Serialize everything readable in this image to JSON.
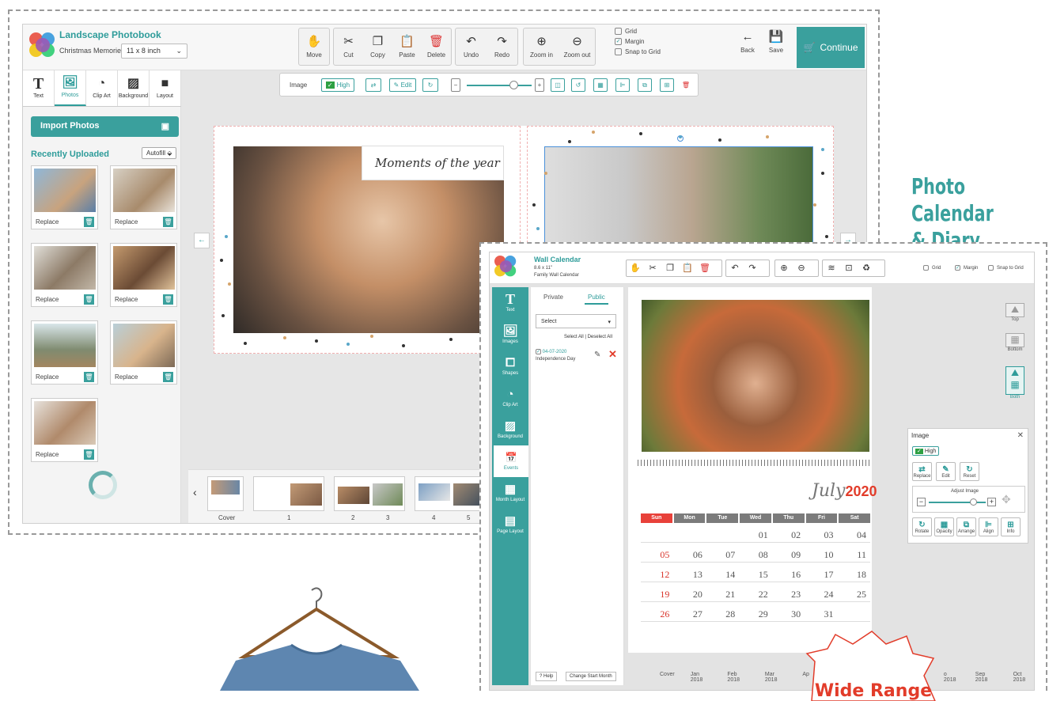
{
  "photobook": {
    "title": "Landscape Photobook",
    "project_name": "Christmas Memories",
    "size": "11 x 8 inch",
    "toolbar": [
      "Move",
      "Cut",
      "Copy",
      "Paste",
      "Delete",
      "Undo",
      "Redo",
      "Zoom in",
      "Zoom out"
    ],
    "options": [
      "Grid",
      "Margin",
      "Snap to Grid"
    ],
    "back": "Back",
    "save": "Save",
    "continue": "Continue",
    "tabs": [
      "Text",
      "Photos",
      "Clip Art",
      "Background",
      "Layout"
    ],
    "import_photos": "Import Photos",
    "recently_uploaded": "Recently Uploaded",
    "autofill": "Autofill",
    "replace": "Replace",
    "image_bar": {
      "label": "Image",
      "quality": "High",
      "edit": "Edit"
    },
    "caption": "Moments of the year",
    "pages": [
      "Cover",
      "1",
      "2",
      "3",
      "4",
      "5"
    ]
  },
  "heading": {
    "line1": "Photo Calendar",
    "line2": "& Diary"
  },
  "calendar": {
    "title": "Wall Calendar",
    "size": "8.6 x 11\"",
    "project": "Family Wall Calendar",
    "options": [
      "Grid",
      "Margin",
      "Snap to Grid"
    ],
    "sidebar": [
      "Text",
      "Images",
      "Shapes",
      "Clip Art",
      "Background",
      "Events",
      "Month Layout",
      "Page Layout"
    ],
    "event_tabs": [
      "Private",
      "Public"
    ],
    "select": "Select",
    "select_all": "Select All",
    "deselect_all": "Deselect All",
    "event_date": "04-07-2020",
    "event_name": "Independence Day",
    "help": "Help",
    "change_start": "Change Start Month",
    "month": "July",
    "year": "2020",
    "days": [
      "Sun",
      "Mon",
      "Tue",
      "Wed",
      "Thu",
      "Fri",
      "Sat"
    ],
    "weeks": [
      [
        "",
        "",
        "",
        "01",
        "02",
        "03",
        "04"
      ],
      [
        "05",
        "06",
        "07",
        "08",
        "09",
        "10",
        "11"
      ],
      [
        "12",
        "13",
        "14",
        "15",
        "16",
        "17",
        "18"
      ],
      [
        "19",
        "20",
        "21",
        "22",
        "23",
        "24",
        "25"
      ],
      [
        "26",
        "27",
        "28",
        "29",
        "30",
        "31",
        ""
      ]
    ],
    "right_options": [
      "Top",
      "Bottom",
      "Both"
    ],
    "image_panel": {
      "title": "Image",
      "quality": "High",
      "buttons1": [
        "Replace",
        "Edit",
        "Reset"
      ],
      "adjust": "Adjust Image",
      "buttons2": [
        "Rotate",
        "Opacity",
        "Arrange",
        "Align",
        "Info"
      ]
    },
    "months": [
      "Cover",
      "Jan 2018",
      "Feb 2018",
      "Mar 2018",
      "Ap",
      "o 2018",
      "Sep 2018",
      "Oct 2018"
    ]
  },
  "badge": "Wide Range"
}
